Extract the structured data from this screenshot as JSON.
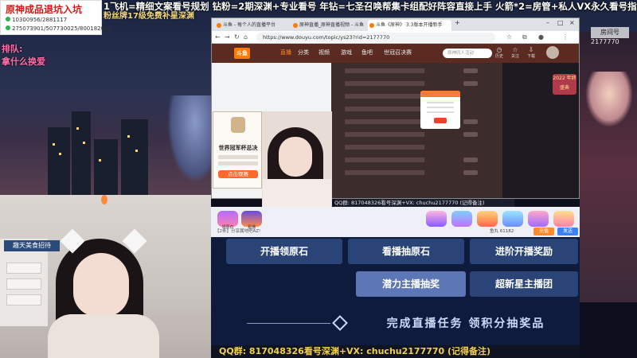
{
  "banner": {
    "line1": "1飞机=精细文案看号规划 钻粉=2期深渊+专业看号 年钻=七圣召唤帮集卡组配好阵容直接上手 火箭*2=房管+私人VX永久看号指导",
    "line2": "粉丝牌17级免费补星深渊"
  },
  "promo": {
    "title": "原神成品退坑入坑",
    "lines": [
      "10300956/2881117",
      "275073901/507730025/800182040"
    ]
  },
  "queue": {
    "label": "排队:",
    "text": "拿什么换爱"
  },
  "deco": {
    "badge": "房间号",
    "id": "2177770"
  },
  "browser": {
    "tabs": [
      "斗鱼 - 每个人的直播平台",
      "原神直播_原神直播视频 - 斗鱼",
      "斗鱼《原神》 3.3版本开播新手"
    ],
    "url": "https://www.douyu.com/topic/ys23?rid=2177770",
    "site_logo": "斗鱼",
    "nav": [
      "直播",
      "分类",
      "视频",
      "游戏",
      "鱼吧",
      "世冠召决赛"
    ],
    "search_placeholder": "原神同人活动",
    "header_icons": [
      {
        "glyph": "◷",
        "label": "历史"
      },
      {
        "glyph": "☆",
        "label": "关注"
      },
      {
        "glyph": "⇩",
        "label": "下载"
      }
    ],
    "badge_2022": "2022 年终盛典"
  },
  "side_card": {
    "title": "世界冠军杯总决",
    "button": "点击观赛"
  },
  "qq_strip": "QQ群: 817048326看号深渊+VX: chuchu2177770 (记得备注)",
  "gift_panel": {
    "labels": [
      "领原石",
      "看播",
      "",
      "",
      "粉丝",
      "",
      "",
      "开播"
    ],
    "chat_placeholder": "【2条】分享属地吧AZ!",
    "fish_count": "鱼丸 61182",
    "charge": "充值",
    "send": "发送"
  },
  "tasks": {
    "row1": [
      "开播领原石",
      "看播抽原石",
      "进阶开播奖励"
    ],
    "row2": [
      "潜力主播抽奖",
      "超新星主播团"
    ],
    "bottom": "完成直播任务 领积分抽奖品"
  },
  "cam_sign": "趣天美食招待",
  "bottom_ribbon": "QQ群: 817048326看号深渊+VX: chuchu2177770 (记得备注)",
  "colors": {
    "accent": "#ff7a00",
    "promo_title": "#d01818",
    "ribbon_text": "#f2d04a",
    "task_panel": "#0e1b3d"
  }
}
